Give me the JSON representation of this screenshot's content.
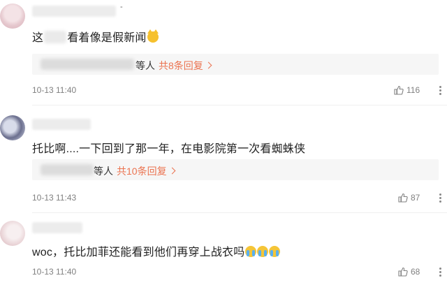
{
  "comments": [
    {
      "name_suffix": "-",
      "text_start": "这",
      "text_end": "看着像是假新闻",
      "emojis": [
        "grinning-cat"
      ],
      "reply_suffix": "等人",
      "reply_link": "共8条回复",
      "time": "10-13 11:40",
      "likes": "116"
    },
    {
      "text": "托比啊....一下回到了那一年，在电影院第一次看蜘蛛侠",
      "reply_suffix": "等人",
      "reply_link": "共10条回复",
      "time": "10-13 11:43",
      "likes": "87"
    },
    {
      "text": "woc，托比加菲还能看到他们再穿上战衣吗",
      "emojis": [
        "crying-face",
        "crying-face",
        "crying-face"
      ],
      "time": "10-13 11:40",
      "likes": "68"
    }
  ],
  "colors": {
    "accent": "#eb7350",
    "muted": "#808080",
    "reply_bg": "#f6f6f6"
  },
  "icons": {
    "like": "thumbs-up-icon",
    "more": "more-vertical-icon"
  }
}
